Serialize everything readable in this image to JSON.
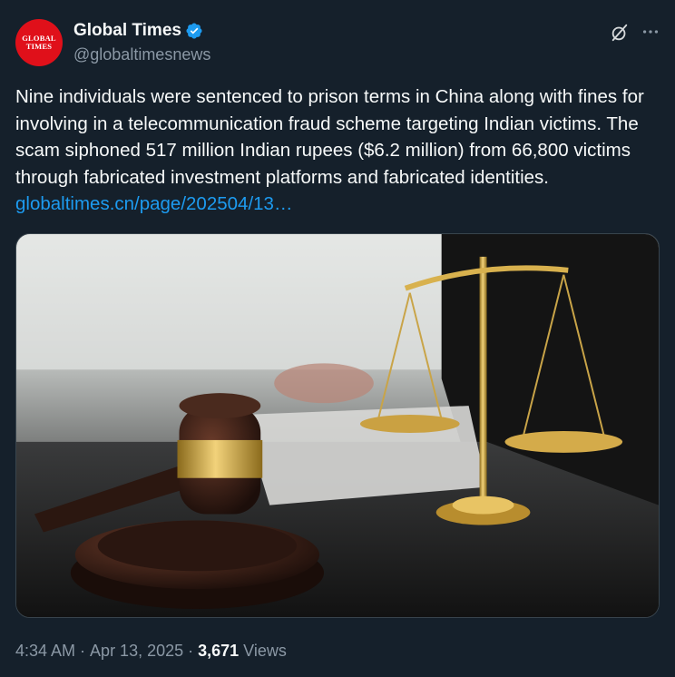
{
  "author": {
    "display_name": "Global Times",
    "handle": "@globaltimesnews",
    "avatar_line1": "GLOBAL",
    "avatar_line2": "TIMES",
    "verified": true
  },
  "tweet": {
    "text": "Nine individuals were sentenced to prison terms in China along with fines for involving in a telecommunication fraud scheme targeting Indian victims. The scam siphoned 517 million Indian rupees ($6.2 million) from 66,800 victims through fabricated investment platforms and fabricated identities. ",
    "link": "globaltimes.cn/page/202504/13…"
  },
  "media": {
    "alt": "Judge's gavel and golden scales of justice on a dark desk"
  },
  "footer": {
    "time": "4:34 AM",
    "dot1": "·",
    "date": "Apr 13, 2025",
    "dot2": "·",
    "views_count": "3,671",
    "views_label": "Views"
  },
  "icons": {
    "grok": "grok-icon",
    "more": "more-icon",
    "verified": "verified-badge-icon"
  },
  "colors": {
    "background": "#15202b",
    "text": "#f7f9f9",
    "secondary": "#8b98a5",
    "link": "#1d9bf0",
    "avatar": "#e0101a"
  }
}
